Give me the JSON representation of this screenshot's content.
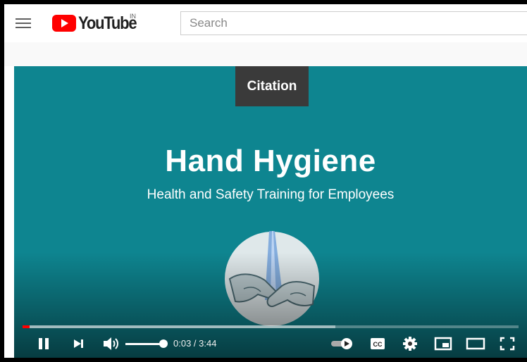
{
  "header": {
    "logo_text": "YouTube",
    "country_code": "IN",
    "search_placeholder": "Search"
  },
  "video": {
    "badge": "Citation",
    "title": "Hand Hygiene",
    "subtitle": "Health and Safety Training for Employees",
    "illustration_icon": "hands-washing-icon",
    "background_color": "#0e8590"
  },
  "player": {
    "time_display": "0:03 / 3:44",
    "progress_fraction": 0.014,
    "buffered_fraction": 0.63,
    "volume_fraction": 1.0,
    "progress_color": "#ff0000",
    "icons": [
      "pause-icon",
      "next-icon",
      "volume-icon",
      "autoplay-toggle-icon",
      "captions-icon",
      "settings-icon",
      "miniplayer-icon",
      "theater-mode-icon",
      "fullscreen-icon"
    ],
    "captions_label": "CC"
  },
  "colors": {
    "youtube_red": "#ff0000"
  }
}
